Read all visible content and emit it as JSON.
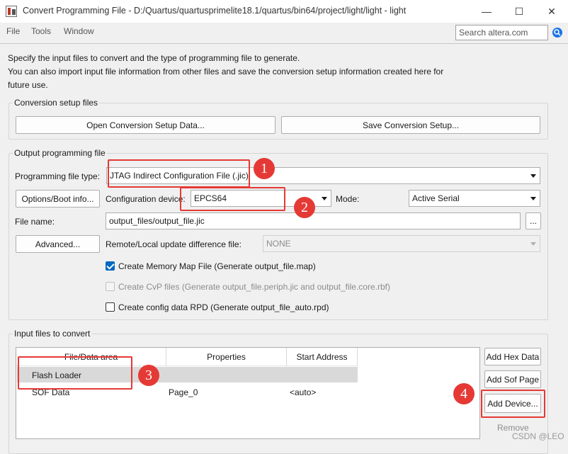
{
  "window": {
    "title": "Convert Programming File - D:/Quartus/quartusprimelite18.1/quartus/bin64/project/light/light - light",
    "minimize_glyph": "—",
    "maximize_glyph": "☐",
    "close_glyph": "✕"
  },
  "menu": {
    "items": [
      "File",
      "Tools",
      "Window"
    ],
    "search_placeholder": "Search altera.com"
  },
  "intro": {
    "line1": "Specify the input files to convert and the type of programming file to generate.",
    "line2": "You can also import input file information from other files and save the conversion setup information created here for",
    "line3": "future use."
  },
  "conversion_setup": {
    "title": "Conversion setup files",
    "open_label": "Open Conversion Setup Data...",
    "save_label": "Save Conversion Setup..."
  },
  "output": {
    "title": "Output programming file",
    "prog_type_label": "Programming file type:",
    "prog_type_value": "JTAG Indirect Configuration File (.jic)",
    "options_label": "Options/Boot info...",
    "config_device_label": "Configuration device:",
    "config_device_value": "EPCS64",
    "mode_label": "Mode:",
    "mode_value": "Active Serial",
    "file_name_label": "File name:",
    "file_name_value": "output_files/output_file.jic",
    "browse_label": "...",
    "advanced_label": "Advanced...",
    "remote_label": "Remote/Local update difference file:",
    "remote_value": "NONE",
    "cb_memory_map": "Create Memory Map File (Generate output_file.map)",
    "cb_cvp": "Create CvP files (Generate output_file.periph.jic and output_file.core.rbf)",
    "cb_rpd": "Create config data RPD (Generate output_file_auto.rpd)"
  },
  "input": {
    "title": "Input files to convert",
    "columns": [
      "File/Data area",
      "Properties",
      "Start Address"
    ],
    "rows": [
      {
        "name": "Flash Loader",
        "properties": "",
        "start": ""
      },
      {
        "name": "SOF Data",
        "properties": "Page_0",
        "start": "<auto>"
      }
    ],
    "add_hex": "Add Hex Data",
    "add_sof": "Add Sof Page",
    "add_device": "Add Device...",
    "remove": "Remove"
  },
  "annotations": [
    "1",
    "2",
    "3",
    "4"
  ],
  "watermark": "CSDN @LEO",
  "colors": {
    "annotation_red": "#e53935",
    "checkbox_blue": "#0067c0"
  }
}
